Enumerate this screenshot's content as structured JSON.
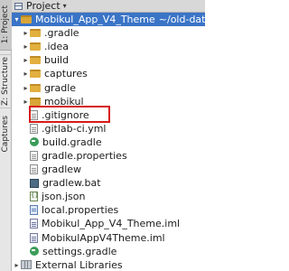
{
  "tool_strip": {
    "tabs": [
      {
        "label": "1: Project"
      },
      {
        "label": "Z: Structure"
      },
      {
        "label": "Captures"
      }
    ]
  },
  "header": {
    "label": "Project",
    "arrow": "▾"
  },
  "root": {
    "caret": "▾",
    "name": "Mobikul_App_V4_Theme",
    "path": "~/old-data/home/us"
  },
  "items": [
    {
      "caret": "▸",
      "label": ".gradle"
    },
    {
      "caret": "▸",
      "label": ".idea"
    },
    {
      "caret": "▸",
      "label": "build"
    },
    {
      "caret": "▸",
      "label": "captures"
    },
    {
      "caret": "▸",
      "label": "gradle"
    },
    {
      "caret": "▸",
      "label": "mobikul"
    },
    {
      "caret": "",
      "label": ".gitignore"
    },
    {
      "caret": "",
      "label": ".gitlab-ci.yml"
    },
    {
      "caret": "",
      "label": "build.gradle"
    },
    {
      "caret": "",
      "label": "gradle.properties"
    },
    {
      "caret": "",
      "label": "gradlew"
    },
    {
      "caret": "",
      "label": "gradlew.bat"
    },
    {
      "caret": "",
      "label": "json.json"
    },
    {
      "caret": "",
      "label": "local.properties"
    },
    {
      "caret": "",
      "label": "Mobikul_App_V4_Theme.iml"
    },
    {
      "caret": "",
      "label": "MobikulAppV4Theme.iml"
    },
    {
      "caret": "",
      "label": "settings.gradle"
    }
  ],
  "external": {
    "caret": "▸",
    "label": "External Libraries"
  },
  "colors": {
    "selection": "#3a74c6",
    "highlight_box": "#d61a1a",
    "folder": "#e2b03f"
  }
}
